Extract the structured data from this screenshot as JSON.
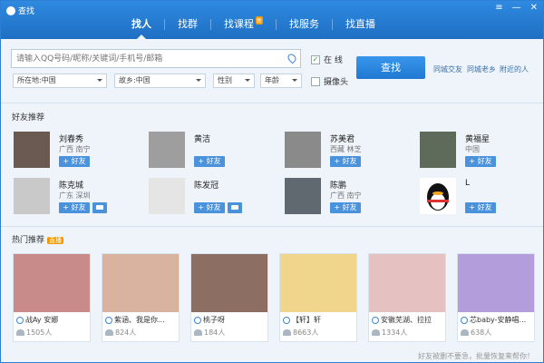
{
  "window": {
    "title": "查找",
    "minimize": "—",
    "close": "✕",
    "menu": "≡"
  },
  "tabs": [
    {
      "label": "找人"
    },
    {
      "label": "找群"
    },
    {
      "label": "找课程",
      "badge": "新"
    },
    {
      "label": "找服务"
    },
    {
      "label": "找直播"
    }
  ],
  "search": {
    "placeholder": "请输入QQ号码/昵称/关键词/手机号/邮箱",
    "online_label": "在 线",
    "camera_label": "摄像头",
    "button_label": "查找",
    "location": "所在地:中国",
    "hometown": "故乡:中国",
    "gender": "性别",
    "age": "年龄",
    "quick_links": [
      "同城交友",
      "同城老乡",
      "附近的人"
    ]
  },
  "friends_section": {
    "title": "好友推荐",
    "add_label": "+ 好友",
    "people": [
      {
        "name": "刘春秀",
        "location": "广西 南宁"
      },
      {
        "name": "黄洁",
        "location": ""
      },
      {
        "name": "苏美君",
        "location": "西藏 林芝"
      },
      {
        "name": "黄福星",
        "location": "中国"
      },
      {
        "name": "陈克城",
        "location": "广东 深圳"
      },
      {
        "name": "陈发冠",
        "location": ""
      },
      {
        "name": "陈鹏",
        "location": "广西 南宁"
      },
      {
        "name": "L",
        "location": ""
      }
    ]
  },
  "hot_section": {
    "title": "热门推荐",
    "badge": "直播",
    "cards": [
      {
        "name": "战Ay 安娜",
        "count": "1505人",
        "color": "#c98a8a"
      },
      {
        "name": "紫涵、我是你...",
        "count": "824人",
        "color": "#d9b3a0"
      },
      {
        "name": "桃子呀",
        "count": "184人",
        "color": "#8d6e63"
      },
      {
        "name": "【轩】轩",
        "count": "8663人",
        "color": "#f0d58c"
      },
      {
        "name": "安徽芜湖、拉拉",
        "count": "1334人",
        "color": "#e6c1c1"
      },
      {
        "name": "芯baby-安静唱...",
        "count": "638人",
        "color": "#b39ddb"
      }
    ]
  },
  "footer": {
    "text": "好友被删不要急，批量恢复来帮你！"
  }
}
